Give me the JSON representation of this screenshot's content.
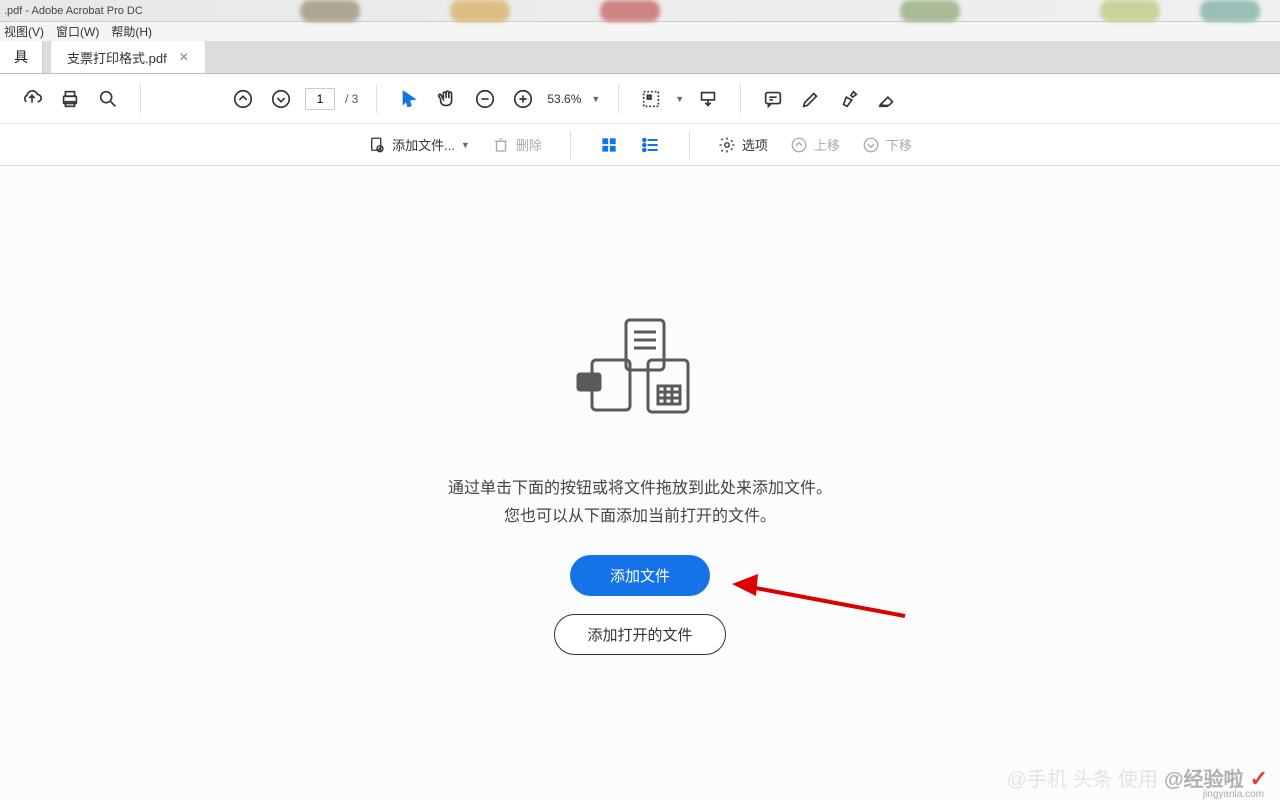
{
  "titlebar": {
    "text": ".pdf - Adobe Acrobat Pro DC"
  },
  "menubar": {
    "view": "视图(V)",
    "window": "窗口(W)",
    "help": "帮助(H)"
  },
  "tabs": {
    "tools": "具",
    "doc": "支票打印格式.pdf"
  },
  "toolbar": {
    "page_current": "1",
    "page_total": "/ 3",
    "zoom": "53.6%"
  },
  "secondbar": {
    "add_files": "添加文件...",
    "batch": "删除",
    "options": "选项",
    "up": "上移",
    "down": "下移"
  },
  "content": {
    "instruction_line1": "通过单击下面的按钮或将文件拖放到此处来添加文件。",
    "instruction_line2": "您也可以从下面添加当前打开的文件。",
    "btn_add": "添加文件",
    "btn_add_open": "添加打开的文件"
  },
  "watermark": {
    "faded": "@手机 头条 使用",
    "brand": "@经验啦",
    "url": "jingyanla.com"
  }
}
